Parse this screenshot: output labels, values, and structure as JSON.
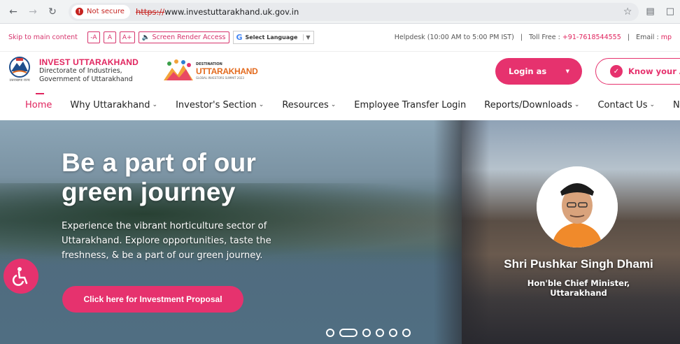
{
  "browser": {
    "security_label": "Not secure",
    "url_scheme": "https://",
    "url_rest": "www.investuttarakhand.uk.gov.in"
  },
  "utility": {
    "skip_label": "Skip to main content",
    "font_decrease": "-A",
    "font_normal": "A",
    "font_increase": "A+",
    "screen_reader": "Screen Render Access",
    "language": "Select Language",
    "helpdesk": "Helpdesk (10:00 AM to 5:00 PM IST)",
    "sep1": "|",
    "toll_label": "Toll Free :",
    "toll_number": "+91-7618544555",
    "sep2": "|",
    "email_label": "Email :",
    "email_value": "mp"
  },
  "header": {
    "brand_title": "INVEST UTTARAKHAND",
    "brand_sub1": "Directorate of Industries,",
    "brand_sub2": "Government of Uttarakhand",
    "emblem_caption": "उत्तराखण्ड राज्य",
    "dest_small": "DESTINATION",
    "dest_big": "UTTARAKHAND",
    "dest_tag": "GLOBAL INVESTORS SUMMIT 2023",
    "login_label": "Login as",
    "know_label": "Know your Ap"
  },
  "nav": [
    {
      "label": "Home",
      "chevron": false
    },
    {
      "label": "Why Uttarakhand",
      "chevron": true
    },
    {
      "label": "Investor's Section",
      "chevron": true
    },
    {
      "label": "Resources",
      "chevron": true
    },
    {
      "label": "Employee Transfer Login",
      "chevron": false
    },
    {
      "label": "Reports/Downloads",
      "chevron": true
    },
    {
      "label": "Contact Us",
      "chevron": true
    },
    {
      "label": "Need",
      "chevron": false
    }
  ],
  "hero": {
    "title_line1": "Be a part of our",
    "title_line2": "green journey",
    "description": "Experience the vibrant horticulture sector of Uttarakhand. Explore opportunities, taste the freshness, & be a part of our green journey.",
    "cta": "Click here for Investment Proposal",
    "slides": 6,
    "active_slide": 2,
    "cm_name": "Shri Pushkar Singh Dhami",
    "cm_title1": "Hon'ble Chief Minister,",
    "cm_title2": "Uttarakhand"
  },
  "colors": {
    "accent": "#e6326e",
    "link_pink": "#d6336c"
  }
}
